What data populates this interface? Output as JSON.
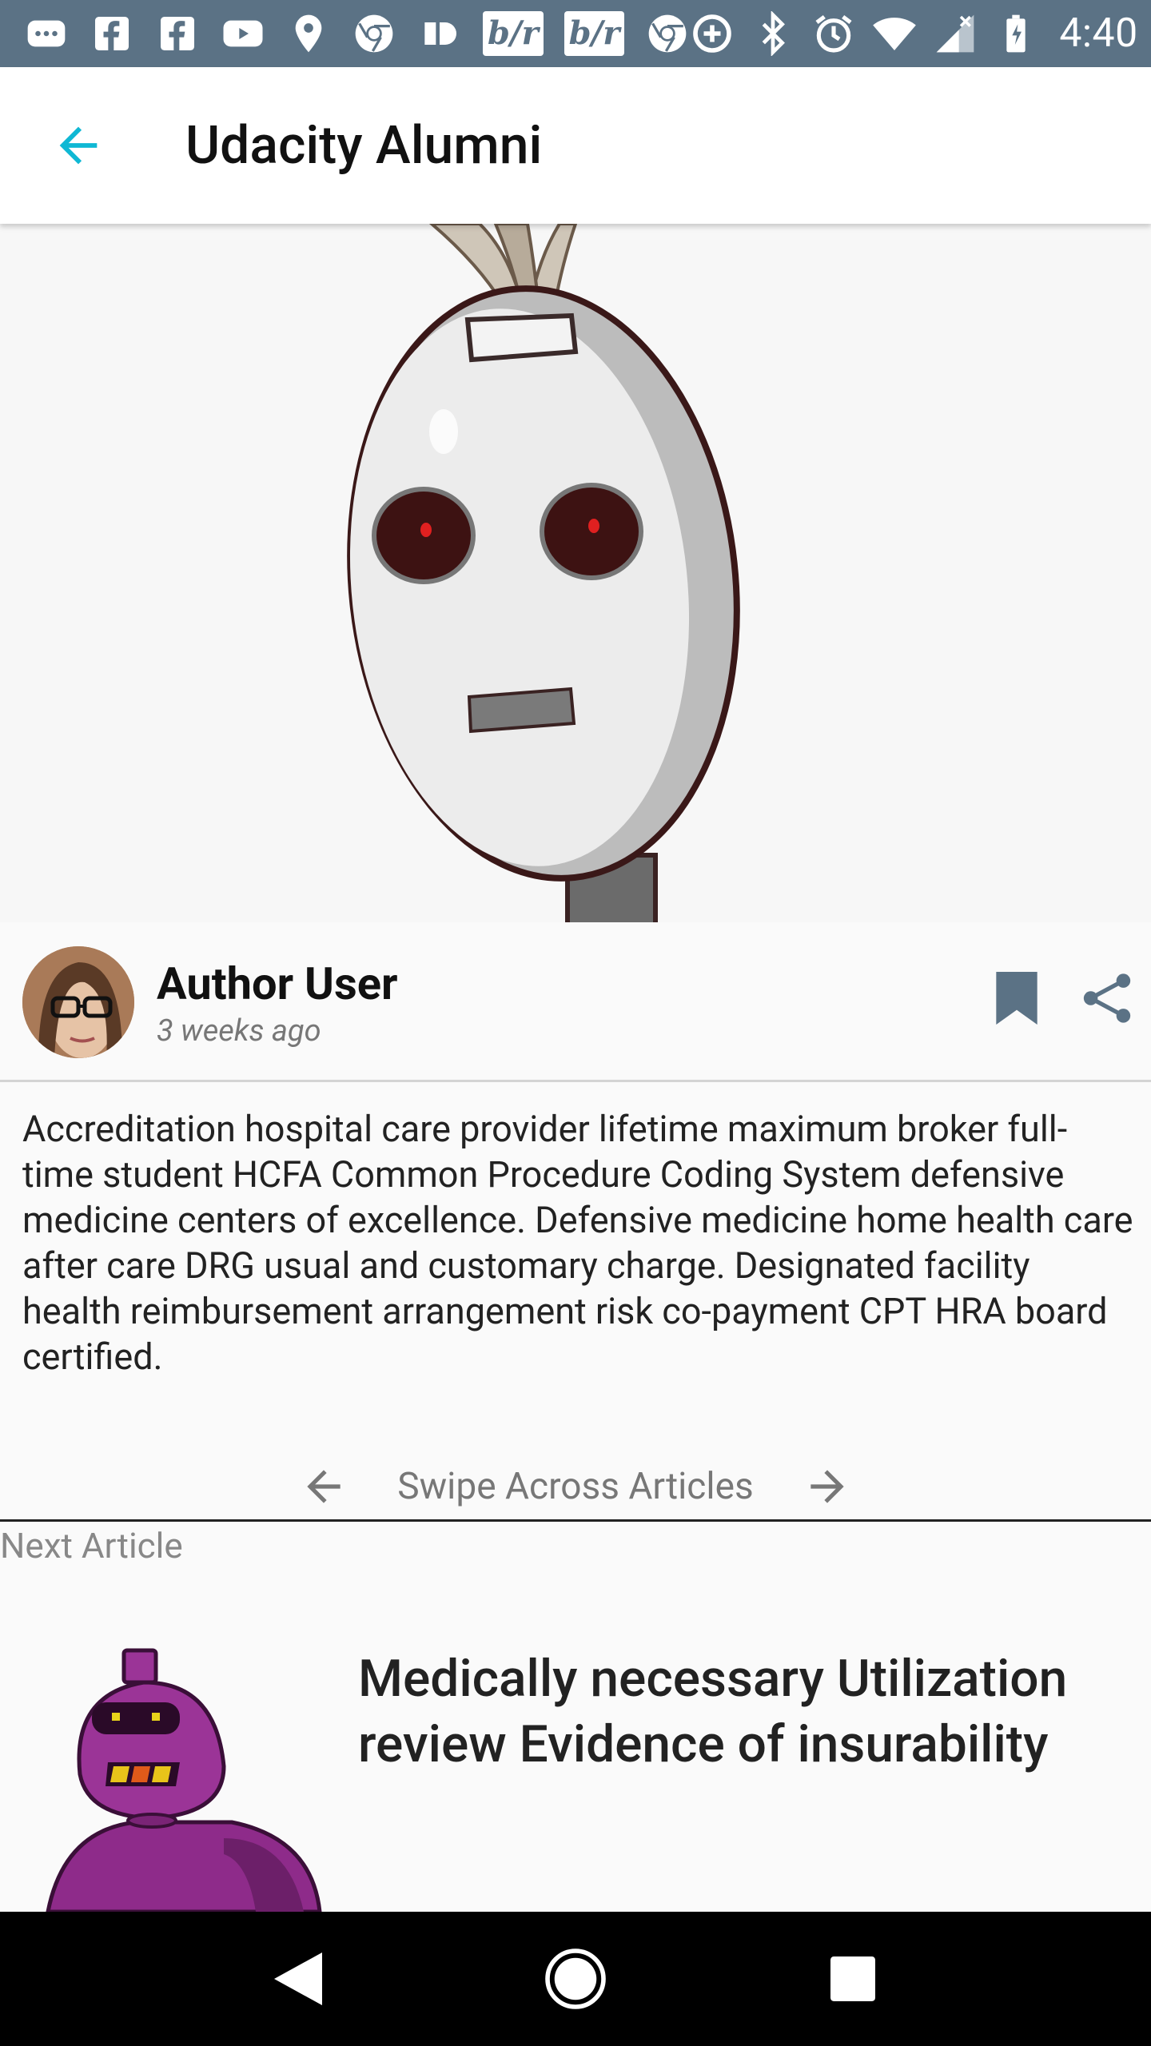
{
  "status_bar": {
    "time": "4:40",
    "br_label": "b/r",
    "colors": {
      "background": "#5b7285"
    },
    "left_icons": [
      "chat-bubble-icon",
      "facebook-icon",
      "facebook-icon",
      "youtube-icon",
      "location-pin-icon",
      "chrome-icon",
      "pause-badge-icon",
      "bleacher-report-icon",
      "bleacher-report-icon",
      "chrome-icon"
    ],
    "right_icons": [
      "data-saver-icon",
      "bluetooth-icon",
      "alarm-icon",
      "wifi-icon",
      "cell-signal-icon",
      "battery-icon"
    ]
  },
  "app_bar": {
    "title": "Udacity Alumni",
    "back_icon": "arrow-back-icon",
    "accent": "#0fb8d4"
  },
  "article": {
    "author": "Author User",
    "time": "3 weeks ago",
    "body": "Accreditation hospital care provider lifetime maximum broker full-time student HCFA Common Procedure Coding System defensive medicine centers of excellence. Defensive medicine home health care after care DRG usual and customary charge. Designated facility health reimbursement arrangement risk co-payment CPT HRA board certified.",
    "actions": [
      "bookmark-icon",
      "share-icon"
    ]
  },
  "swipe": {
    "label": "Swipe Across Articles"
  },
  "next_article": {
    "section_label": "Next Article",
    "title": "Medically necessary Utilization review Evidence of insurability"
  },
  "nav_bar": {
    "buttons": [
      "back-triangle-icon",
      "home-circle-icon",
      "recents-square-icon"
    ]
  }
}
